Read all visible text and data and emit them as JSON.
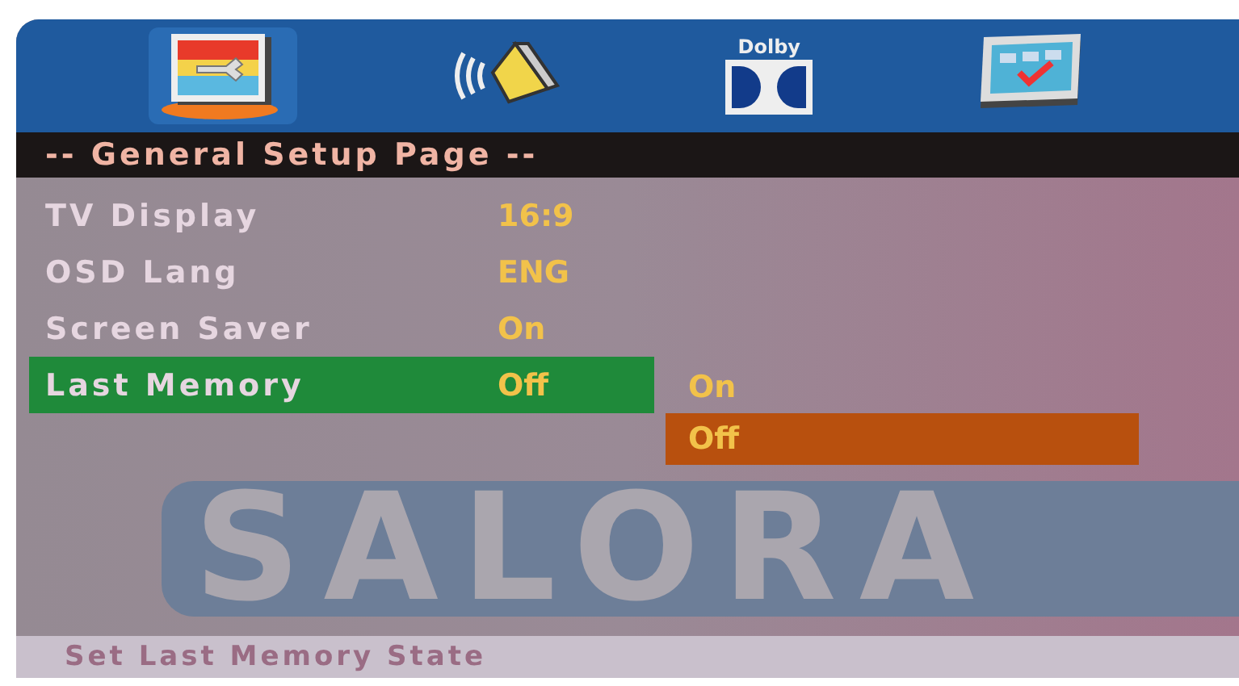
{
  "tabs": [
    {
      "kind": "general",
      "selected": true
    },
    {
      "kind": "audio",
      "selected": false
    },
    {
      "kind": "dolby",
      "label": "Dolby",
      "selected": false
    },
    {
      "kind": "preferences",
      "selected": false
    }
  ],
  "page_title": "-- General Setup Page --",
  "background_logo": "SALORA",
  "items": [
    {
      "label": "TV Display",
      "value": "16:9",
      "selected": false
    },
    {
      "label": "OSD Lang",
      "value": "ENG",
      "selected": false
    },
    {
      "label": "Screen Saver",
      "value": "On",
      "selected": false
    },
    {
      "label": "Last Memory",
      "value": "Off",
      "selected": true
    }
  ],
  "options": [
    {
      "label": "On",
      "selected": false
    },
    {
      "label": "Off",
      "selected": true
    }
  ],
  "status_bar": "Set Last Memory State"
}
